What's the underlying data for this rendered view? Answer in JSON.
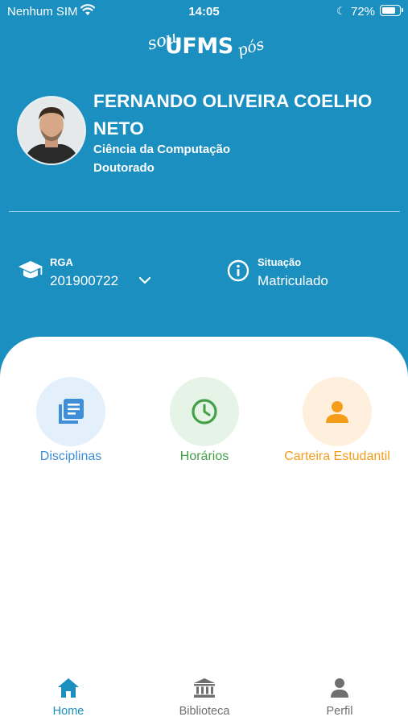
{
  "status_bar": {
    "carrier": "Nenhum SIM",
    "time": "14:05",
    "battery": "72%"
  },
  "logo": {
    "sou": "sou",
    "main": "UFMS",
    "pos": "pós"
  },
  "profile": {
    "name": "FERNANDO OLIVEIRA COELHO NETO",
    "course": "Ciência da Computação",
    "level": "Doutorado"
  },
  "enrollment": {
    "rga_label": "RGA",
    "rga_value": "201900722",
    "situation_label": "Situação",
    "situation_value": "Matriculado"
  },
  "shortcuts": [
    {
      "label": "Disciplinas",
      "icon": "book-list-icon",
      "color": "#3e8ed8",
      "bg": "#e3f0fb"
    },
    {
      "label": "Horários",
      "icon": "clock-icon",
      "color": "#43a047",
      "bg": "#e6f3e7"
    },
    {
      "label": "Carteira Estudantil",
      "icon": "person-icon",
      "color": "#f59c1a",
      "bg": "#fff0de"
    }
  ],
  "tabs": [
    {
      "label": "Home",
      "icon": "home-icon",
      "active": true
    },
    {
      "label": "Biblioteca",
      "icon": "library-icon",
      "active": false
    },
    {
      "label": "Perfil",
      "icon": "person-icon",
      "active": false
    }
  ],
  "colors": {
    "primary": "#1b8fc0",
    "tab_active": "#1b8fc0",
    "tab_inactive": "#6f6f6f"
  }
}
